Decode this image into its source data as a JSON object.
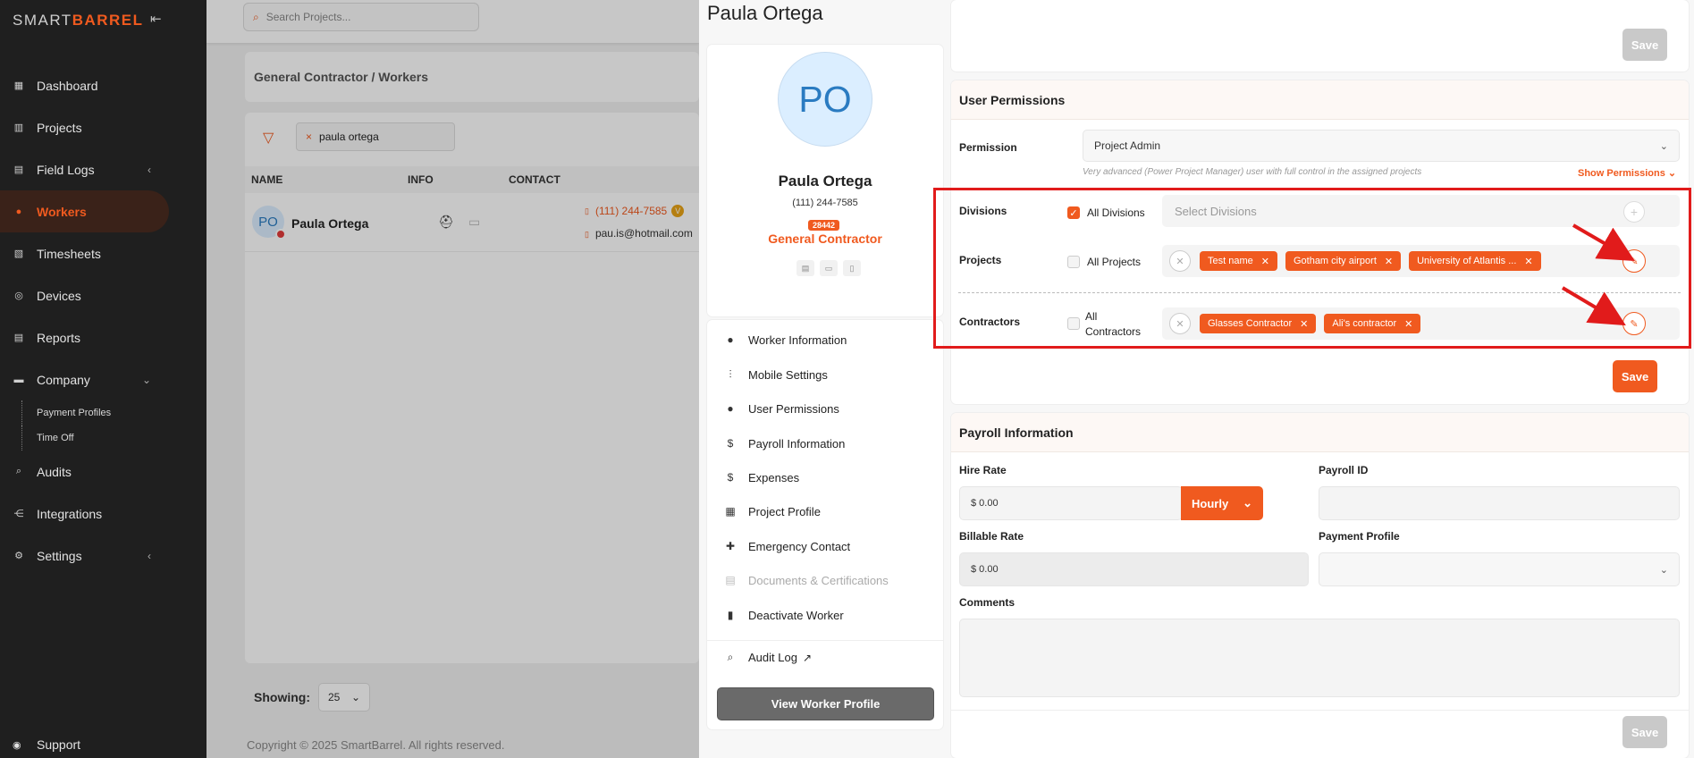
{
  "sidebar": {
    "logo_prefix": "SMART",
    "logo_brand": "BARREL",
    "items": [
      {
        "label": "Dashboard"
      },
      {
        "label": "Projects"
      },
      {
        "label": "Field Logs"
      },
      {
        "label": "Workers"
      },
      {
        "label": "Timesheets"
      },
      {
        "label": "Devices"
      },
      {
        "label": "Reports"
      },
      {
        "label": "Company"
      }
    ],
    "sub_items": [
      {
        "label": "Payment Profiles"
      },
      {
        "label": "Time Off"
      }
    ],
    "items2": [
      {
        "label": "Audits"
      },
      {
        "label": "Integrations"
      },
      {
        "label": "Settings"
      }
    ],
    "support": "Support"
  },
  "main": {
    "search_placeholder": "Search Projects...",
    "breadcrumb": "General Contractor  /  Workers",
    "filter_value": "paula ortega",
    "columns": [
      "NAME",
      "INFO",
      "CONTACT"
    ],
    "row": {
      "initials": "PO",
      "name": "Paula Ortega",
      "phone": "(111) 244-7585",
      "verified": "V",
      "email": "pau.is@hotmail.com"
    },
    "showing_label": "Showing:",
    "showing_value": "25",
    "copyright": "Copyright © 2025 SmartBarrel. All rights reserved."
  },
  "drawer": {
    "title": "Paula Ortega",
    "profile": {
      "initials": "PO",
      "name": "Paula Ortega",
      "phone": "(111) 244-7585",
      "id": "28442",
      "role": "General Contractor"
    },
    "menu": [
      {
        "label": "Worker Information"
      },
      {
        "label": "Mobile Settings"
      },
      {
        "label": "User Permissions"
      },
      {
        "label": "Payroll Information"
      },
      {
        "label": "Expenses"
      },
      {
        "label": "Project Profile"
      },
      {
        "label": "Emergency Contact"
      },
      {
        "label": "Documents & Certifications"
      },
      {
        "label": "Deactivate Worker"
      },
      {
        "label": "Audit Log"
      }
    ],
    "view_profile": "View Worker Profile",
    "save_label": "Save",
    "permissions": {
      "title": "User Permissions",
      "permission_label": "Permission",
      "permission_value": "Project Admin",
      "permission_hint": "Very advanced (Power Project Manager) user with full control in the assigned projects",
      "show_permissions": "Show Permissions",
      "divisions_label": "Divisions",
      "all_divisions": "All Divisions",
      "divisions_placeholder": "Select Divisions",
      "projects_label": "Projects",
      "all_projects": "All Projects",
      "project_tags": [
        "Test name",
        "Gotham city airport",
        "University of Atlantis ..."
      ],
      "contractors_label": "Contractors",
      "all_contractors_1": "All",
      "all_contractors_2": "Contractors",
      "contractor_tags": [
        "Glasses Contractor",
        "Ali's contractor"
      ]
    },
    "payroll": {
      "title": "Payroll Information",
      "hire_rate_label": "Hire Rate",
      "hire_rate_value": "$ 0.00",
      "hire_unit": "Hourly",
      "payroll_id_label": "Payroll ID",
      "billable_label": "Billable Rate",
      "billable_value": "$ 0.00",
      "payment_profile_label": "Payment Profile",
      "comments_label": "Comments"
    }
  },
  "colors": {
    "accent": "#f05a1f",
    "highlight": "#e11b1b",
    "sidebar_bg": "#1f1f1f"
  }
}
